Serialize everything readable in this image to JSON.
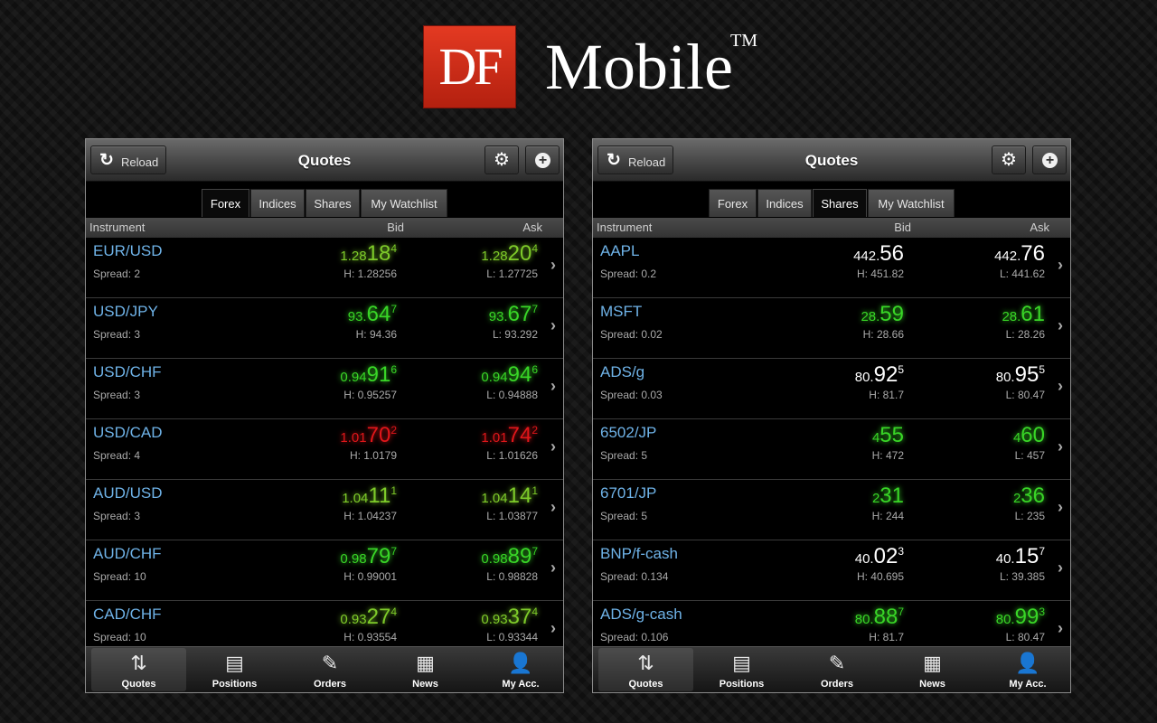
{
  "logo": {
    "mark": "DF",
    "text": "Mobile",
    "tm": "TM"
  },
  "colors": {
    "up": "#39d627",
    "down": "#e0161a",
    "neutral": "#ffffff",
    "instrument": "#6fb3e8"
  },
  "screens": [
    {
      "header": {
        "reload": "Reload",
        "title": "Quotes",
        "reload_icon": "reload-icon",
        "settings_icon": "gear-icon",
        "add_icon": "plus-circle-icon"
      },
      "tabs": [
        {
          "label": "Forex",
          "active": true
        },
        {
          "label": "Indices",
          "active": false
        },
        {
          "label": "Shares",
          "active": false
        },
        {
          "label": "My Watchlist",
          "active": false
        }
      ],
      "columns": {
        "instrument": "Instrument",
        "bid": "Bid",
        "ask": "Ask"
      },
      "rows": [
        {
          "name": "EUR/USD",
          "spread": "Spread: 2",
          "bid": {
            "small": "1.28",
            "big": "18",
            "sup": "4"
          },
          "ask": {
            "small": "1.28",
            "big": "20",
            "sup": "4"
          },
          "high": "H: 1.28256",
          "low": "L: 1.27725",
          "color": "#7ecb2a"
        },
        {
          "name": "USD/JPY",
          "spread": "Spread: 3",
          "bid": {
            "small": "93.",
            "big": "64",
            "sup": "7"
          },
          "ask": {
            "small": "93.",
            "big": "67",
            "sup": "7"
          },
          "high": "H: 94.36",
          "low": "L: 93.292",
          "color": "#39d627"
        },
        {
          "name": "USD/CHF",
          "spread": "Spread: 3",
          "bid": {
            "small": "0.94",
            "big": "91",
            "sup": "6"
          },
          "ask": {
            "small": "0.94",
            "big": "94",
            "sup": "6"
          },
          "high": "H: 0.95257",
          "low": "L: 0.94888",
          "color": "#39d627"
        },
        {
          "name": "USD/CAD",
          "spread": "Spread: 4",
          "bid": {
            "small": "1.01",
            "big": "70",
            "sup": "2"
          },
          "ask": {
            "small": "1.01",
            "big": "74",
            "sup": "2"
          },
          "high": "H: 1.0179",
          "low": "L: 1.01626",
          "color": "#e0161a"
        },
        {
          "name": "AUD/USD",
          "spread": "Spread: 3",
          "bid": {
            "small": "1.04",
            "big": "11",
            "sup": "1"
          },
          "ask": {
            "small": "1.04",
            "big": "14",
            "sup": "1"
          },
          "high": "H: 1.04237",
          "low": "L: 1.03877",
          "color": "#7ecb2a"
        },
        {
          "name": "AUD/CHF",
          "spread": "Spread: 10",
          "bid": {
            "small": "0.98",
            "big": "79",
            "sup": "7"
          },
          "ask": {
            "small": "0.98",
            "big": "89",
            "sup": "7"
          },
          "high": "H: 0.99001",
          "low": "L: 0.98828",
          "color": "#39d627"
        },
        {
          "name": "CAD/CHF",
          "spread": "Spread: 10",
          "bid": {
            "small": "0.93",
            "big": "27",
            "sup": "4"
          },
          "ask": {
            "small": "0.93",
            "big": "37",
            "sup": "4"
          },
          "high": "H: 0.93554",
          "low": "L: 0.93344",
          "color": "#7ecb2a"
        }
      ],
      "tabbar": [
        {
          "label": "Quotes",
          "icon": "quotes-arrows-icon",
          "active": true
        },
        {
          "label": "Positions",
          "icon": "positions-list-icon",
          "active": false
        },
        {
          "label": "Orders",
          "icon": "orders-icon",
          "active": false
        },
        {
          "label": "News",
          "icon": "news-icon",
          "active": false
        },
        {
          "label": "My Acc.",
          "icon": "user-account-icon",
          "active": false
        }
      ]
    },
    {
      "header": {
        "reload": "Reload",
        "title": "Quotes",
        "reload_icon": "reload-icon",
        "settings_icon": "gear-icon",
        "add_icon": "plus-circle-icon"
      },
      "tabs": [
        {
          "label": "Forex",
          "active": false
        },
        {
          "label": "Indices",
          "active": false
        },
        {
          "label": "Shares",
          "active": true
        },
        {
          "label": "My Watchlist",
          "active": false
        }
      ],
      "columns": {
        "instrument": "Instrument",
        "bid": "Bid",
        "ask": "Ask"
      },
      "rows": [
        {
          "name": "AAPL",
          "spread": "Spread: 0.2",
          "bid": {
            "small": "442.",
            "big": "56",
            "sup": ""
          },
          "ask": {
            "small": "442.",
            "big": "76",
            "sup": ""
          },
          "high": "H: 451.82",
          "low": "L: 441.62",
          "color": "#ffffff"
        },
        {
          "name": "MSFT",
          "spread": "Spread: 0.02",
          "bid": {
            "small": "28.",
            "big": "59",
            "sup": ""
          },
          "ask": {
            "small": "28.",
            "big": "61",
            "sup": ""
          },
          "high": "H: 28.66",
          "low": "L: 28.26",
          "color": "#39d627"
        },
        {
          "name": "ADS/g",
          "spread": "Spread: 0.03",
          "bid": {
            "small": "80.",
            "big": "92",
            "sup": "5"
          },
          "ask": {
            "small": "80.",
            "big": "95",
            "sup": "5"
          },
          "high": "H: 81.7",
          "low": "L: 80.47",
          "color": "#ffffff"
        },
        {
          "name": "6502/JP",
          "spread": "Spread: 5",
          "bid": {
            "small": "4",
            "big": "55",
            "sup": ""
          },
          "ask": {
            "small": "4",
            "big": "60",
            "sup": ""
          },
          "high": "H: 472",
          "low": "L: 457",
          "color": "#39d627"
        },
        {
          "name": "6701/JP",
          "spread": "Spread: 5",
          "bid": {
            "small": "2",
            "big": "31",
            "sup": ""
          },
          "ask": {
            "small": "2",
            "big": "36",
            "sup": ""
          },
          "high": "H: 244",
          "low": "L: 235",
          "color": "#39d627"
        },
        {
          "name": "BNP/f-cash",
          "spread": "Spread: 0.134",
          "bid": {
            "small": "40.",
            "big": "02",
            "sup": "3"
          },
          "ask": {
            "small": "40.",
            "big": "15",
            "sup": "7"
          },
          "high": "H: 40.695",
          "low": "L: 39.385",
          "color": "#ffffff"
        },
        {
          "name": "ADS/g-cash",
          "spread": "Spread: 0.106",
          "bid": {
            "small": "80.",
            "big": "88",
            "sup": "7"
          },
          "ask": {
            "small": "80.",
            "big": "99",
            "sup": "3"
          },
          "high": "H: 81.7",
          "low": "L: 80.47",
          "color": "#39d627"
        }
      ],
      "tabbar": [
        {
          "label": "Quotes",
          "icon": "quotes-arrows-icon",
          "active": true
        },
        {
          "label": "Positions",
          "icon": "positions-list-icon",
          "active": false
        },
        {
          "label": "Orders",
          "icon": "orders-icon",
          "active": false
        },
        {
          "label": "News",
          "icon": "news-icon",
          "active": false
        },
        {
          "label": "My Acc.",
          "icon": "user-account-icon",
          "active": false
        }
      ]
    }
  ]
}
